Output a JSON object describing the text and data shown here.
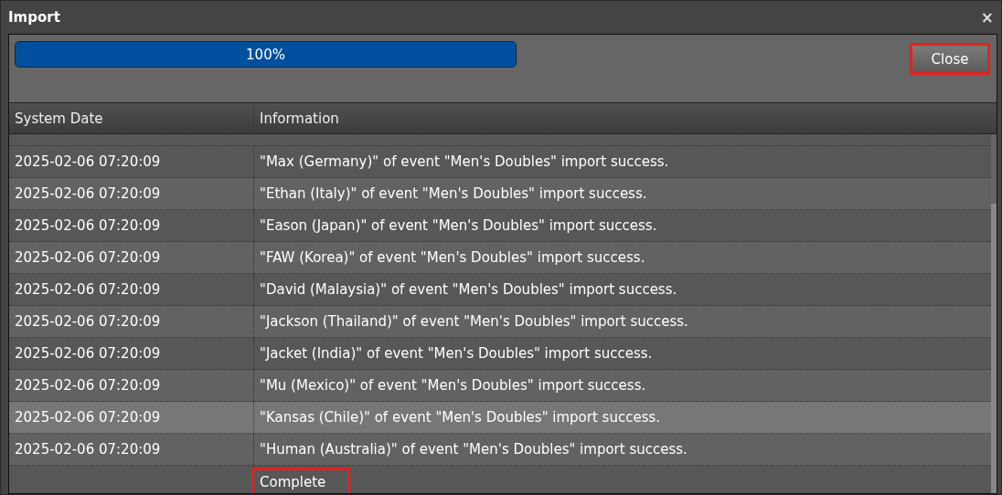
{
  "window": {
    "title": "Import",
    "close": "×"
  },
  "progress": {
    "level": 1,
    "label": "100%"
  },
  "close_button": {
    "label": "Close",
    "highlighted": true
  },
  "table": {
    "columns": [
      "System Date",
      "Information"
    ],
    "rows": [
      {
        "date": "2025-02-06 07:20:09",
        "info": "\"Max (Germany)\" of event \"Men's Doubles\" import success.",
        "selected": false
      },
      {
        "date": "2025-02-06 07:20:09",
        "info": "\"Ethan (Italy)\" of event \"Men's Doubles\" import success.",
        "selected": false
      },
      {
        "date": "2025-02-06 07:20:09",
        "info": "\"Eason (Japan)\" of event \"Men's Doubles\" import success.",
        "selected": false
      },
      {
        "date": "2025-02-06 07:20:09",
        "info": "\"FAW (Korea)\" of event \"Men's Doubles\" import success.",
        "selected": false
      },
      {
        "date": "2025-02-06 07:20:09",
        "info": "\"David (Malaysia)\" of event \"Men's Doubles\" import success.",
        "selected": false
      },
      {
        "date": "2025-02-06 07:20:09",
        "info": "\"Jackson (Thailand)\" of event \"Men's Doubles\" import success.",
        "selected": false
      },
      {
        "date": "2025-02-06 07:20:09",
        "info": "\"Jacket (India)\" of event \"Men's Doubles\" import success.",
        "selected": false
      },
      {
        "date": "2025-02-06 07:20:09",
        "info": "\"Mu (Mexico)\" of event \"Men's Doubles\" import success.",
        "selected": false
      },
      {
        "date": "2025-02-06 07:20:09",
        "info": "\"Kansas (Chile)\" of event \"Men's Doubles\" import success.",
        "selected": true
      },
      {
        "date": "2025-02-06 07:20:09",
        "info": "\"Human (Australia)\" of event \"Men's Doubles\" import success.",
        "selected": false
      }
    ],
    "footer": {
      "info": "Complete",
      "highlighted": true
    }
  }
}
